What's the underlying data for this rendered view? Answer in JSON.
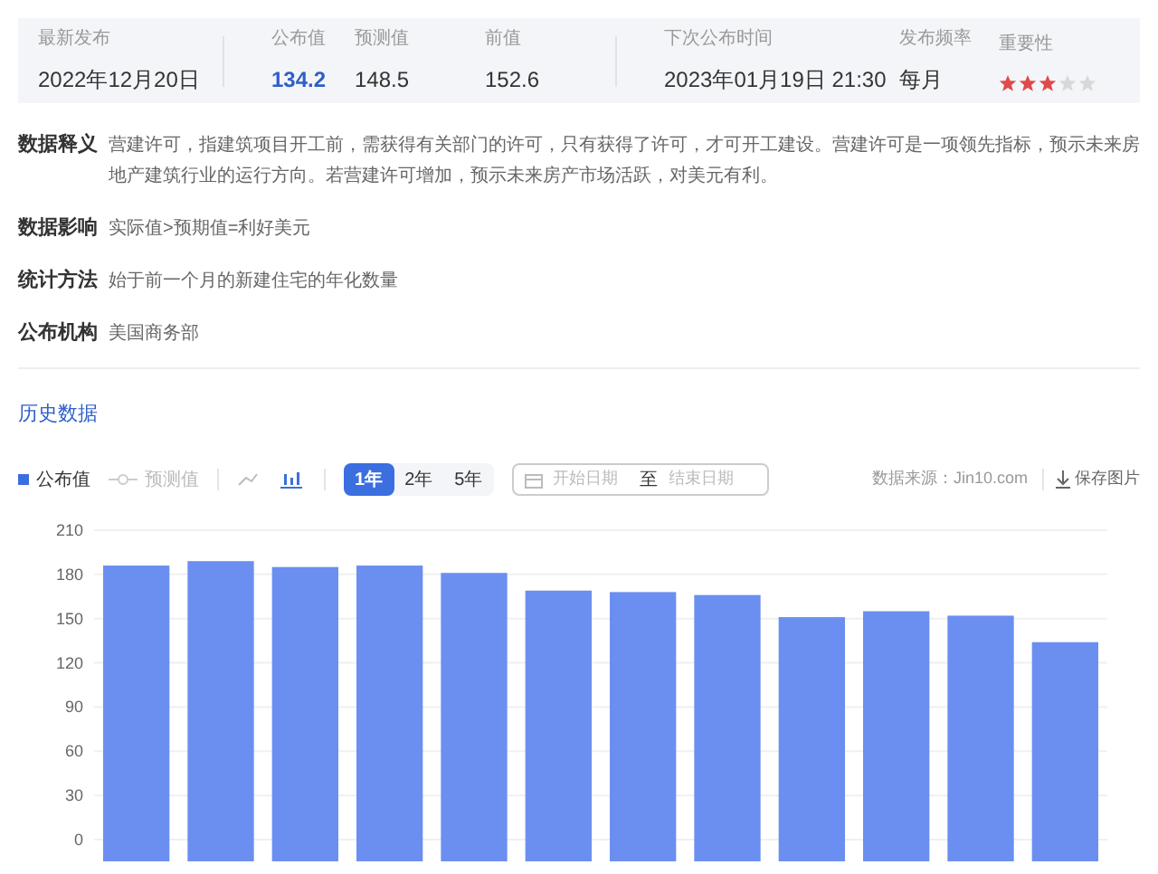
{
  "summary": [
    {
      "label": "最新发布",
      "value": "2022年12月20日",
      "kind": "text"
    },
    {
      "label": "公布值",
      "value": "134.2",
      "kind": "highlight"
    },
    {
      "label": "预测值",
      "value": "148.5",
      "kind": "text"
    },
    {
      "label": "前值",
      "value": "152.6",
      "kind": "text"
    },
    {
      "label": "下次公布时间",
      "value": "2023年01月19日 21:30",
      "kind": "text"
    },
    {
      "label": "发布频率",
      "value": "每月",
      "kind": "text"
    },
    {
      "label": "重要性",
      "stars": 3,
      "kind": "stars"
    }
  ],
  "details": [
    {
      "label": "数据释义",
      "text": "营建许可，指建筑项目开工前，需获得有关部门的许可，只有获得了许可，才可开工建设。营建许可是一项领先指标，预示未来房地产建筑行业的运行方向。若营建许可增加，预示未来房产市场活跃，对美元有利。"
    },
    {
      "label": "数据影响",
      "text": "实际值>预期值=利好美元"
    },
    {
      "label": "统计方法",
      "text": "始于前一个月的新建住宅的年化数量"
    },
    {
      "label": "公布机构",
      "text": "美国商务部"
    }
  ],
  "history": {
    "title": "历史数据",
    "legend": [
      {
        "label": "公布值",
        "on": true,
        "kind": "square"
      },
      {
        "label": "预测值",
        "on": false,
        "kind": "line"
      }
    ],
    "chart_types": [
      {
        "kind": "line",
        "selected": false
      },
      {
        "kind": "bar",
        "selected": true
      }
    ],
    "ranges": [
      {
        "label": "1年",
        "selected": true
      },
      {
        "label": "2年",
        "selected": false
      },
      {
        "label": "5年",
        "selected": false
      }
    ],
    "date_range": {
      "start_placeholder": "开始日期",
      "separator": "至",
      "end_placeholder": "结束日期"
    },
    "source": "数据来源：Jin10.com",
    "save": "保存图片",
    "chart_data": {
      "type": "bar",
      "grid": true,
      "ylim": [
        0,
        210
      ],
      "yticks": [
        0,
        30,
        60,
        90,
        120,
        150,
        180,
        210
      ],
      "series": [
        {
          "color": "#6b8ff0",
          "values": [
            186,
            189,
            185,
            186,
            181,
            169,
            168,
            166,
            151,
            155,
            152,
            134
          ]
        }
      ]
    }
  }
}
